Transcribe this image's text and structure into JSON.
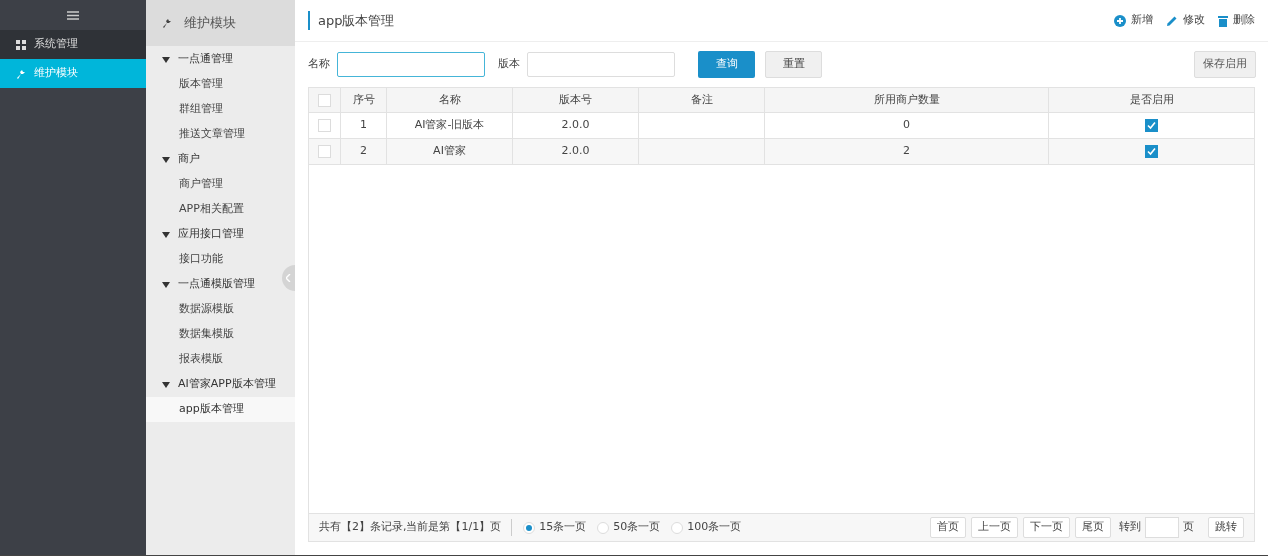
{
  "nav": {
    "items": [
      {
        "label": "系统管理",
        "selected": false
      },
      {
        "label": "维护模块",
        "selected": true
      }
    ]
  },
  "subnav": {
    "title": "维护模块",
    "groups": [
      {
        "label": "一点通管理",
        "expanded": true,
        "children": [
          {
            "label": "版本管理",
            "selected": false
          },
          {
            "label": "群组管理",
            "selected": false
          },
          {
            "label": "推送文章管理",
            "selected": false
          }
        ]
      },
      {
        "label": "商户",
        "expanded": true,
        "children": [
          {
            "label": "商户管理",
            "selected": false
          },
          {
            "label": "APP相关配置",
            "selected": false
          }
        ]
      },
      {
        "label": "应用接口管理",
        "expanded": true,
        "children": [
          {
            "label": "接口功能",
            "selected": false
          }
        ]
      },
      {
        "label": "一点通模版管理",
        "expanded": true,
        "children": [
          {
            "label": "数据源模版",
            "selected": false
          },
          {
            "label": "数据集模版",
            "selected": false
          },
          {
            "label": "报表模版",
            "selected": false
          }
        ]
      },
      {
        "label": "AI管家APP版本管理",
        "expanded": true,
        "children": [
          {
            "label": "app版本管理",
            "selected": true
          }
        ]
      }
    ]
  },
  "page": {
    "title": "app版本管理",
    "actions": [
      {
        "label": "新增"
      },
      {
        "label": "修改"
      },
      {
        "label": "删除"
      }
    ]
  },
  "filters": [
    {
      "label": "名称",
      "focused": true
    },
    {
      "label": "版本",
      "focused": false
    }
  ],
  "buttons": [
    {
      "label": "查询",
      "kind": "primary"
    },
    {
      "label": "重置",
      "kind": "default"
    }
  ],
  "save_button": "保存启用",
  "table": {
    "all_checked": false,
    "columns": [
      "序号",
      "名称",
      "版本号",
      "备注",
      "所用商户数量",
      "是否启用"
    ],
    "rows": [
      {
        "checked": false,
        "cells": [
          "1",
          "AI管家-旧版本",
          "2.0.0",
          null,
          "0"
        ],
        "enabled": true
      },
      {
        "checked": false,
        "cells": [
          "2",
          "AI管家",
          "2.0.0",
          null,
          "2"
        ],
        "enabled": true
      }
    ]
  },
  "pager": {
    "summary": "共有【2】条记录,当前是第【1/1】页",
    "sizes": [
      {
        "label": "15条一页",
        "selected": true
      },
      {
        "label": "50条一页",
        "selected": false
      },
      {
        "label": "100条一页",
        "selected": false
      }
    ],
    "buttons": [
      "首页",
      "上一页",
      "下一页",
      "尾页"
    ],
    "goto_label": "转到",
    "page_label": "页",
    "jump": "跳转"
  }
}
